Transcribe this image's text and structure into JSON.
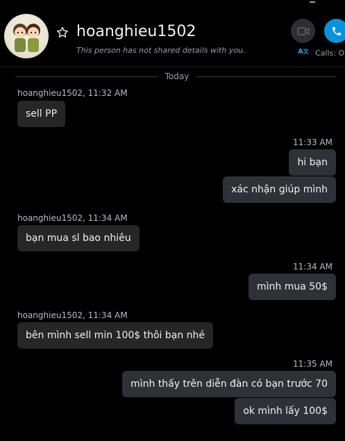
{
  "header": {
    "name": "hoanghieu1502",
    "subtitle": "This person has not shared details with you.",
    "calls_label": "Calls: O"
  },
  "conversation": {
    "date_separator": "Today",
    "groups": [
      {
        "direction": "incoming",
        "meta": "hoanghieu1502, 11:32 AM",
        "messages": [
          "sell PP"
        ]
      },
      {
        "direction": "outgoing",
        "meta": "11:33 AM",
        "messages": [
          "hi bạn",
          "xác nhận giúp mình"
        ]
      },
      {
        "direction": "incoming",
        "meta": "hoanghieu1502, 11:34 AM",
        "messages": [
          "bạn mua sl bao nhiêu"
        ]
      },
      {
        "direction": "outgoing",
        "meta": "11:34 AM",
        "messages": [
          "mình mua 50$"
        ]
      },
      {
        "direction": "incoming",
        "meta": "hoanghieu1502, 11:34 AM",
        "messages": [
          "bên mình sell min 100$ thôi bạn nhé"
        ]
      },
      {
        "direction": "outgoing",
        "meta": "11:35 AM",
        "messages": [
          "mình thấy trên diễn đàn có bạn trước 70",
          "ok mình lấy 100$"
        ]
      }
    ]
  },
  "colors": {
    "background": "#000000",
    "bubble_incoming": "#262626",
    "bubble_outgoing": "#2e3238",
    "accent_call": "#0a93d8"
  },
  "icons": {
    "star": "star-icon",
    "video": "video-camera-icon",
    "call": "phone-icon",
    "translate": "translate-icon"
  }
}
